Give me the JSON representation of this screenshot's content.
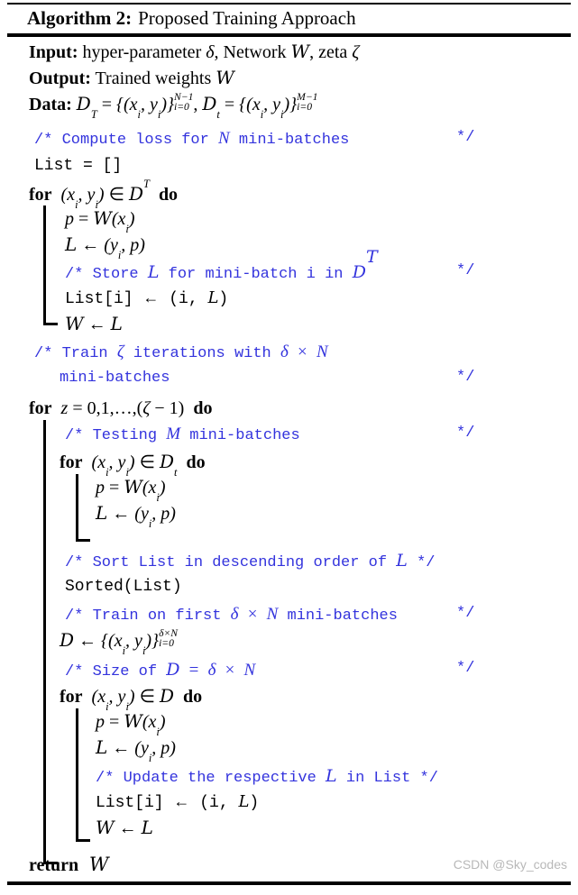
{
  "algorithm": {
    "label": "Algorithm 2:",
    "title": "Proposed Training Approach",
    "comment_color": "#3333dd",
    "watermark": "CSDN @Sky_codes",
    "header": {
      "input_label": "Input:",
      "input_text": "hyper-parameter δ, Network 𝒲, zeta ζ",
      "output_label": "Output:",
      "output_text": "Trained weights 𝒲",
      "data_label": "Data:",
      "data_text": "𝒟T = {(xi, yi)}i=0N−1, 𝒟t = {(xi, yi)}i=0M−1"
    },
    "lines": [
      {
        "id": "c1",
        "kind": "comment",
        "text": "/* Compute loss for N mini-batches",
        "end": "*/"
      },
      {
        "id": "s1",
        "kind": "code",
        "text": "List = []"
      },
      {
        "id": "f1",
        "kind": "for",
        "keyword": "for",
        "cond": "(xi, yi) ∈ 𝒟T",
        "do": "do"
      },
      {
        "id": "s2",
        "kind": "code",
        "text": "p = 𝒲(xi)"
      },
      {
        "id": "s3",
        "kind": "code",
        "text": "ℒ ← (yi, p)"
      },
      {
        "id": "c2",
        "kind": "comment",
        "text": "/* Store ℒ for mini-batch i in 𝒟𝒯",
        "end": "*/"
      },
      {
        "id": "s4",
        "kind": "code",
        "text": "List[i] ← (i, ℒ)"
      },
      {
        "id": "s5",
        "kind": "code",
        "text": "𝒲 ← ℒ"
      },
      {
        "id": "c3a",
        "kind": "comment",
        "text": "/* Train ζ iterations with δ × N"
      },
      {
        "id": "c3b",
        "kind": "comment",
        "text": "mini-batches",
        "end": "*/"
      },
      {
        "id": "f2",
        "kind": "for",
        "keyword": "for",
        "cond": "z = 0,1,…,(ζ − 1)",
        "do": "do"
      },
      {
        "id": "c4",
        "kind": "comment",
        "text": "/* Testing M mini-batches",
        "end": "*/"
      },
      {
        "id": "f3",
        "kind": "for",
        "keyword": "for",
        "cond": "(xi, yi) ∈ 𝒟t",
        "do": "do"
      },
      {
        "id": "s6",
        "kind": "code",
        "text": "p = 𝒲(xi)"
      },
      {
        "id": "s7",
        "kind": "code",
        "text": "ℒ ← (yi, p)"
      },
      {
        "id": "c5",
        "kind": "comment",
        "text": "/* Sort List in descending order of ℒ */"
      },
      {
        "id": "s8",
        "kind": "code",
        "text": "Sorted(List)"
      },
      {
        "id": "c6",
        "kind": "comment",
        "text": "/* Train on first δ × N mini-batches",
        "end": "*/"
      },
      {
        "id": "s9",
        "kind": "code",
        "text": "𝒟 ← {(xi, yi)}i=0δ×N"
      },
      {
        "id": "c7",
        "kind": "comment",
        "text": "/* Size of 𝒟 = δ × N",
        "end": "*/"
      },
      {
        "id": "f4",
        "kind": "for",
        "keyword": "for",
        "cond": "(xi, yi) ∈ 𝒟",
        "do": "do"
      },
      {
        "id": "s10",
        "kind": "code",
        "text": "p = 𝒲(xi)"
      },
      {
        "id": "s11",
        "kind": "code",
        "text": "ℒ ← (yi, p)"
      },
      {
        "id": "c8",
        "kind": "comment",
        "text": "/* Update the respective ℒ in List */"
      },
      {
        "id": "s12",
        "kind": "code",
        "text": "List[i] ← (i, ℒ)"
      },
      {
        "id": "s13",
        "kind": "code",
        "text": "𝒲 ← ℒ"
      },
      {
        "id": "r1",
        "kind": "return",
        "keyword": "return",
        "value": "𝒲"
      }
    ]
  }
}
